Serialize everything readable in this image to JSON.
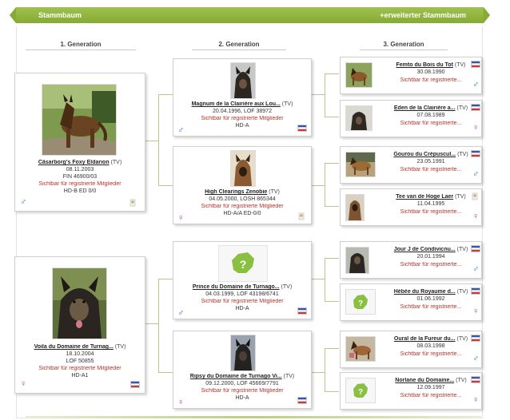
{
  "header": {
    "title": "Stammbaum",
    "extended_link": "+erweiterter Stammbaum"
  },
  "generations": [
    "1. Generation",
    "2. Generation",
    "3. Generation"
  ],
  "gen1": [
    {
      "name": "Cäsarborg's Foxy Eldarion",
      "tv": "(TV)",
      "date": "08.11.2003",
      "reg": "FIN 46900/03",
      "visible": "Sichtbar für registrierte Mitglieder",
      "health": "HD-B ED 0/0",
      "sex": "♂"
    },
    {
      "name": "Voila du Domaine de Turnag...",
      "tv": "(TV)",
      "date": "18.10.2004",
      "reg": "LOF 50855",
      "visible": "Sichtbar für registrierte Mitglieder",
      "health": "HD-A1",
      "sex": "♀"
    }
  ],
  "gen2": [
    {
      "name": "Magnum de la Clairière aux Lou...",
      "tv": "(TV)",
      "date_reg": "20.04.1996, LOF 38972",
      "visible": "Sichtbar für registrierte Mitglieder",
      "health": "HD-A",
      "sex": "♂"
    },
    {
      "name": "High Clearings Zenobie",
      "tv": "(TV)",
      "date_reg": "04.05.2000, LOSH 865344",
      "visible": "Sichtbar für registrierte Mitglieder",
      "health": "HD-A/A ED-0/0",
      "sex": "♀"
    },
    {
      "name": "Prince du Domaine de Turnago...",
      "tv": "(TV)",
      "date_reg": "04.03.1999, LOF 43198/6741",
      "visible": "Sichtbar für registrierte Mitglieder",
      "health": "HD-A",
      "sex": "♂"
    },
    {
      "name": "Ripsy du Domaine de Turnago Vi...",
      "tv": "(TV)",
      "date_reg": "09.12.2000, LOF 45669/7791",
      "visible": "Sichtbar für registrierte Mitglieder",
      "health": "HD-A",
      "sex": "♀"
    }
  ],
  "gen3": [
    {
      "name": "Femto du Bois du Tot",
      "tv": "(TV)",
      "date": "30.08.1990",
      "visible": "Sichtbar für registrierte...",
      "sex": "♂"
    },
    {
      "name": "Eden de la Clairière a...",
      "tv": "(TV)",
      "date": "07.08.1989",
      "visible": "Sichtbar für registrierte...",
      "sex": "♀"
    },
    {
      "name": "Gourou du Crépuscul...",
      "tv": "(TV)",
      "date": "23.05.1991",
      "visible": "Sichtbar für registrierte...",
      "sex": "♂"
    },
    {
      "name": "Tee van de Hoge Laer",
      "tv": "(TV)",
      "date": "11.04.1995",
      "visible": "Sichtbar für registrierte...",
      "sex": "♀"
    },
    {
      "name": "Jour J de Condivicnu...",
      "tv": "(TV)",
      "date": "20.01.1994",
      "visible": "Sichtbar für registrierte...",
      "sex": "♂"
    },
    {
      "name": "Hébée du Royaume d...",
      "tv": "(TV)",
      "date": "01.06.1992",
      "visible": "Sichtbar für registrierte...",
      "sex": "♀"
    },
    {
      "name": "Oural de la Fureur du...",
      "tv": "(TV)",
      "date": "08.03.1998",
      "visible": "Sichtbar für registrierte...",
      "sex": "♂"
    },
    {
      "name": "Norlane du Domaine...",
      "tv": "(TV)",
      "date": "12.09.1997",
      "visible": "Sichtbar für registrierte...",
      "sex": "♀"
    }
  ],
  "colors": {
    "header_green": "#8fb33c",
    "link_red": "#b5332a",
    "male_blue": "#2d7ec1",
    "female_purple": "#a43db5",
    "connector": "#b6c98c"
  },
  "icons": {
    "male": "male-symbol-icon",
    "female": "female-symbol-icon",
    "flag": "country-flag-icon",
    "no_photo": "no-photo-placeholder-icon"
  }
}
